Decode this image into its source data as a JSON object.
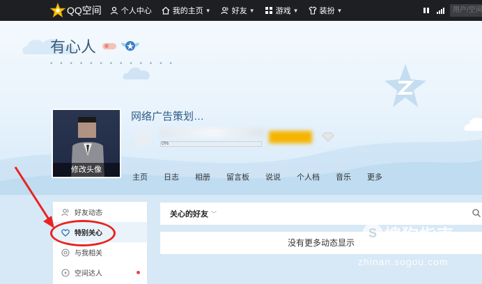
{
  "topbar": {
    "logo_text": "QQ空间",
    "nav": [
      {
        "label": "个人中心",
        "icon": "person-icon",
        "caret": false
      },
      {
        "label": "我的主页",
        "icon": "home-icon",
        "caret": true
      },
      {
        "label": "好友",
        "icon": "friends-icon",
        "caret": true
      },
      {
        "label": "游戏",
        "icon": "grid-icon",
        "caret": true
      },
      {
        "label": "装扮",
        "icon": "shirt-icon",
        "caret": true
      }
    ],
    "search_placeholder": "用户/空间"
  },
  "profile": {
    "site_title": "有心人",
    "dots": "• • • • • • • • • • • • •",
    "avatar_edit_label": "修改头像",
    "user_name": "网络广告策划…",
    "level_percent_label": "0%",
    "level_progress": 0.0
  },
  "main_nav": {
    "tabs": [
      "主页",
      "日志",
      "相册",
      "留言板",
      "说说",
      "个人档",
      "音乐",
      "更多"
    ]
  },
  "sidebar": {
    "items": [
      {
        "label": "好友动态",
        "icon": "friends-icon",
        "active": false,
        "dot": false
      },
      {
        "label": "特别关心",
        "icon": "heart-icon",
        "active": true,
        "dot": false
      },
      {
        "label": "与我相关",
        "icon": "at-icon",
        "active": false,
        "dot": false
      },
      {
        "label": "空间达人",
        "icon": "play-circle-icon",
        "active": false,
        "dot": true
      }
    ]
  },
  "feed": {
    "filter_label": "关心的好友",
    "empty_message": "没有更多动态显示"
  },
  "watermark": {
    "circle_letter": "S",
    "text": "搜狗指南",
    "url": "zhinan.sogou.com"
  },
  "colors": {
    "topbar_bg": "#1d1f22",
    "accent_blue": "#2f5b86",
    "highlight_red": "#e8231f",
    "notify_dot": "#e9464a",
    "level_badge": "#f5b400"
  }
}
